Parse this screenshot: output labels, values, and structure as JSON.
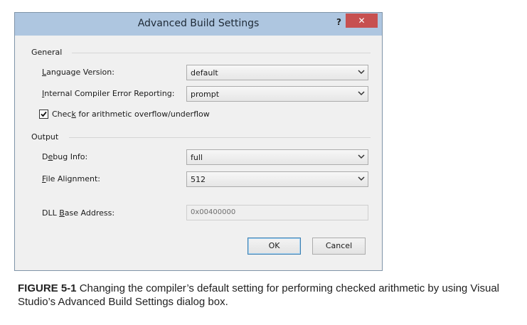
{
  "window": {
    "title": "Advanced Build Settings",
    "help_label": "?",
    "close_label": "✕"
  },
  "general": {
    "group_label": "General",
    "language_version": {
      "label_pre": "",
      "label_key": "L",
      "label_post": "anguage Version:",
      "value": "default"
    },
    "internal_error": {
      "label_pre": "",
      "label_key": "I",
      "label_post": "nternal Compiler Error Reporting:",
      "value": "prompt"
    },
    "overflow_check": {
      "label_pre": "Chec",
      "label_key": "k",
      "label_post": " for arithmetic overflow/underflow",
      "checked": true
    }
  },
  "output": {
    "group_label": "Output",
    "debug_info": {
      "label_pre": "D",
      "label_key": "e",
      "label_post": "bug Info:",
      "value": "full"
    },
    "file_alignment": {
      "label_pre": "",
      "label_key": "F",
      "label_post": "ile Alignment:",
      "value": "512"
    },
    "dll_base": {
      "label_pre": "DLL ",
      "label_key": "B",
      "label_post": "ase Address:",
      "value": "0x00400000"
    }
  },
  "buttons": {
    "ok": "OK",
    "cancel": "Cancel"
  },
  "caption": {
    "figure": "FIGURE 5-1",
    "text": "Changing the compiler’s default setting for performing checked arithmetic by using Visual Studio’s Advanced Build Settings dialog box."
  }
}
